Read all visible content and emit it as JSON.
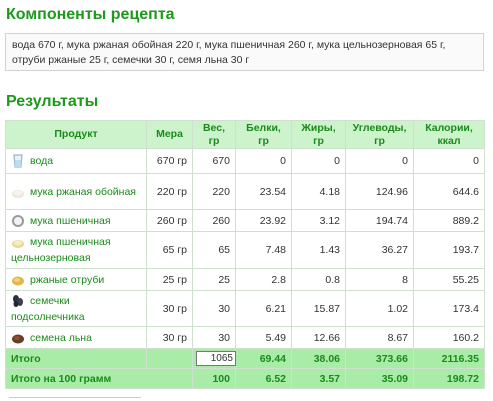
{
  "headings": {
    "components": "Компоненты рецепта",
    "results": "Результаты"
  },
  "recipe_text": "вода 670 г, мука ржаная обойная 220 г, мука пшеничная 260 г, мука цельнозерновая 65 г, отруби ржаные 25 г, семечки 30 г, семя льна 30 г",
  "table": {
    "columns": [
      "Продукт",
      "Мера",
      "Вес, гр",
      "Белки, гр",
      "Жиры, гр",
      "Углеводы, гр",
      "Калории, ккал"
    ],
    "rows": [
      {
        "name": "вода",
        "icon": "water-glass-icon",
        "measure": "670 гр",
        "weight": "670",
        "protein": "0",
        "fat": "0",
        "carbs": "0",
        "kcal": "0"
      },
      {
        "name": "мука ржаная обойная",
        "icon": "rye-flour-icon",
        "measure": "220 гр",
        "weight": "220",
        "protein": "23.54",
        "fat": "4.18",
        "carbs": "124.96",
        "kcal": "644.6"
      },
      {
        "name": "мука пшеничная",
        "icon": "wheat-flour-icon",
        "measure": "260 гр",
        "weight": "260",
        "protein": "23.92",
        "fat": "3.12",
        "carbs": "194.74",
        "kcal": "889.2"
      },
      {
        "name": "мука пшеничная цельнозерновая",
        "icon": "wholegrain-flour-icon",
        "measure": "65 гр",
        "weight": "65",
        "protein": "7.48",
        "fat": "1.43",
        "carbs": "36.27",
        "kcal": "193.7"
      },
      {
        "name": "ржаные отруби",
        "icon": "rye-bran-icon",
        "measure": "25 гр",
        "weight": "25",
        "protein": "2.8",
        "fat": "0.8",
        "carbs": "8",
        "kcal": "55.25"
      },
      {
        "name": "семечки подсолнечника",
        "icon": "sunflower-seeds-icon",
        "measure": "30 гр",
        "weight": "30",
        "protein": "6.21",
        "fat": "15.87",
        "carbs": "1.02",
        "kcal": "173.4"
      },
      {
        "name": "семена льна",
        "icon": "flax-seeds-icon",
        "measure": "30 гр",
        "weight": "30",
        "protein": "5.49",
        "fat": "12.66",
        "carbs": "8.67",
        "kcal": "160.2"
      }
    ],
    "total": {
      "label": "Итого",
      "weight_input": "1065",
      "protein": "69.44",
      "fat": "38.06",
      "carbs": "373.66",
      "kcal": "2116.35"
    },
    "per100": {
      "label": "Итого на 100 грамм",
      "weight": "100",
      "protein": "6.52",
      "fat": "3.57",
      "carbs": "35.09",
      "kcal": "198.72"
    }
  },
  "colors": {
    "accent": "#1b9a1b",
    "header_bg": "#ccf3cc",
    "total_bg": "#a8eca8"
  }
}
